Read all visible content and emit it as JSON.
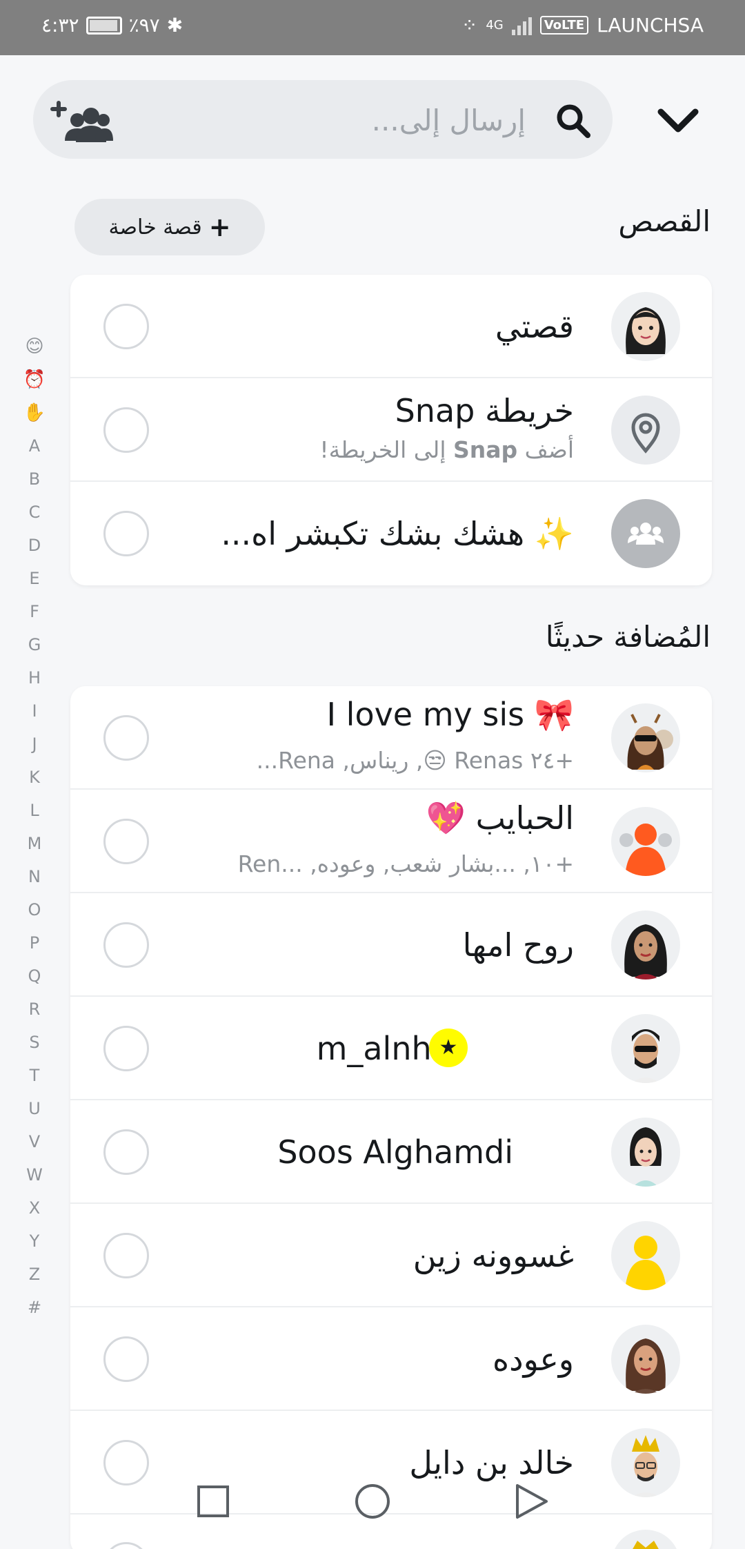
{
  "status_bar": {
    "time": "٤:٣٢",
    "battery": "٪٩٧",
    "network": "4G",
    "volte": "VoLTE",
    "carrier": "LAUNCHSA"
  },
  "header": {
    "search_placeholder": "إرسال إلى...",
    "add_friends_icon": "add-friends-icon",
    "search_icon": "search-icon",
    "collapse_icon": "chevron-down-icon"
  },
  "stories_section": {
    "title": "القصص",
    "private_story_button": "قصة خاصة",
    "items": [
      {
        "title": "قصتي",
        "subtitle": ""
      },
      {
        "title": "خريطة Snap",
        "subtitle_pre": "أضف ",
        "subtitle_bold": "Snap",
        "subtitle_post": " إلى الخريطة!"
      },
      {
        "title": "✨ هشك بشك تكبشر اه..."
      }
    ]
  },
  "recent_section": {
    "title": "المُضافة حديثًا",
    "items": [
      {
        "title": "I love my sis 🎀",
        "subtitle": "+٢٤ Renas 😒, ريناس, Rena..."
      },
      {
        "title": "الحبايب 💖",
        "subtitle": "+١٠, ...بشار شعب, وعوده, ...Ren"
      },
      {
        "title": "روح امها"
      },
      {
        "title": "m_alnhet"
      },
      {
        "title": "Soos Alghamdi"
      },
      {
        "title": "غسوونه زين"
      },
      {
        "title": "وعوده"
      },
      {
        "title": "خالد بن دايل"
      }
    ]
  },
  "alpha_index": [
    "😊",
    "⏰",
    "✋",
    "A",
    "B",
    "C",
    "D",
    "E",
    "F",
    "G",
    "H",
    "I",
    "J",
    "K",
    "L",
    "M",
    "N",
    "O",
    "P",
    "Q",
    "R",
    "S",
    "T",
    "U",
    "V",
    "W",
    "X",
    "Y",
    "Z",
    "#"
  ],
  "colors": {
    "accent_yellow": "#fffc00",
    "background": "#f6f7f9",
    "card": "#ffffff",
    "muted_text": "#8e9297"
  }
}
